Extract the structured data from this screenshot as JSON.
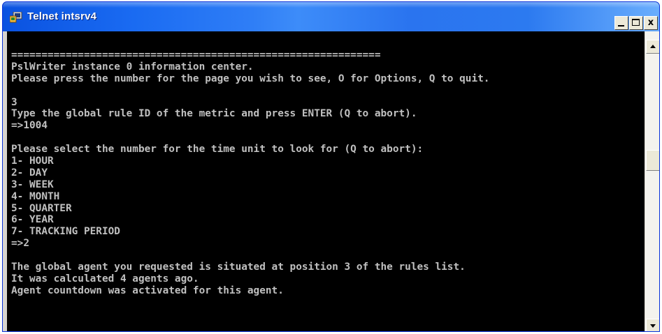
{
  "window": {
    "title": "Telnet intsrv4",
    "icon": "telnet-app-icon",
    "controls": {
      "minimize_icon": "minimize-icon",
      "maximize_icon": "maximize-icon",
      "close_label": "x"
    }
  },
  "console": {
    "lines": [
      "=============================================================",
      "PslWriter instance 0 information center.",
      "Please press the number for the page you wish to see, O for Options, Q to quit.",
      "",
      "3",
      "Type the global rule ID of the metric and press ENTER (Q to abort).",
      "=>1004",
      "",
      "Please select the number for the time unit to look for (Q to abort):",
      "1- HOUR",
      "2- DAY",
      "3- WEEK",
      "4- MONTH",
      "5- QUARTER",
      "6- YEAR",
      "7- TRACKING PERIOD",
      "=>2",
      "",
      "The global agent you requested is situated at position 3 of the rules list.",
      "It was calculated 4 agents ago.",
      "Agent countdown was activated for this agent."
    ]
  },
  "scrollbar": {
    "up_icon": "scroll-up-arrow-icon",
    "down_icon": "scroll-down-arrow-icon"
  },
  "colors": {
    "console_background": "#000000",
    "console_text": "#c0c0c0",
    "titlebar_accent": "#0a52e0"
  }
}
